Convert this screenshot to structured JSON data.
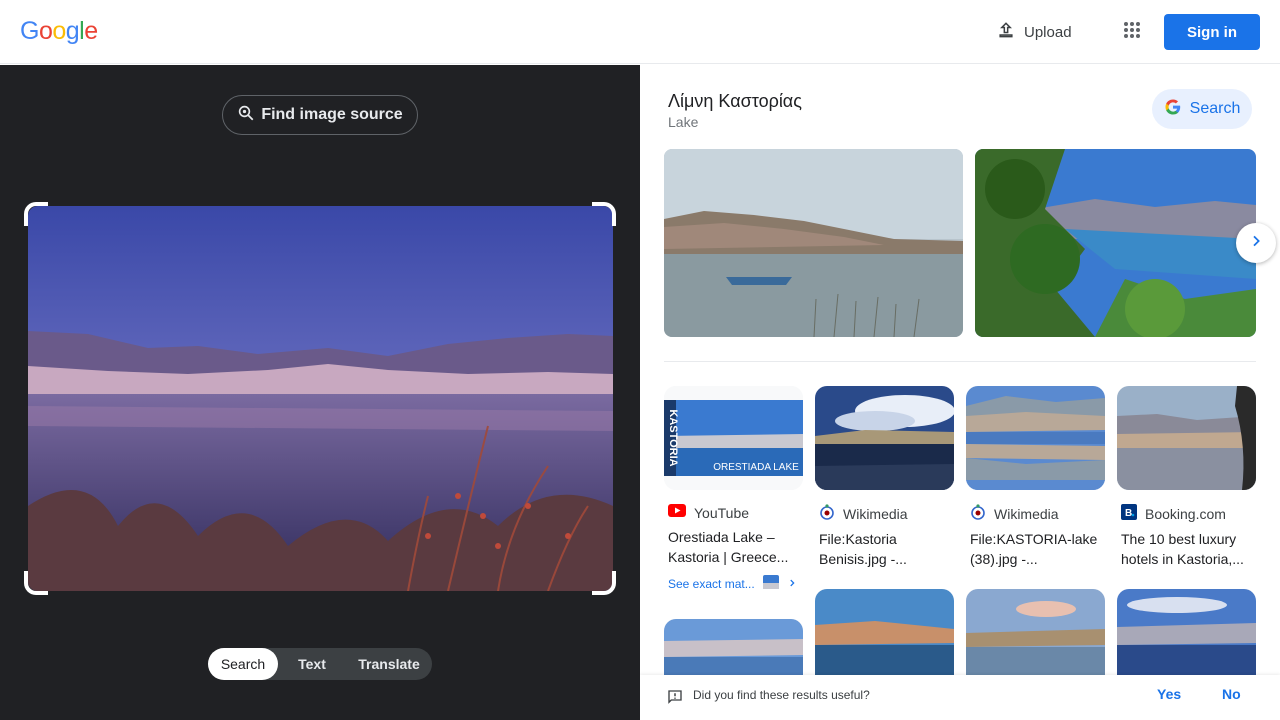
{
  "header": {
    "logo_letters": [
      {
        "ch": "G",
        "color": "#4285F4"
      },
      {
        "ch": "o",
        "color": "#EA4335"
      },
      {
        "ch": "o",
        "color": "#FBBC05"
      },
      {
        "ch": "g",
        "color": "#4285F4"
      },
      {
        "ch": "l",
        "color": "#34A853"
      },
      {
        "ch": "e",
        "color": "#EA4335"
      }
    ],
    "upload_label": "Upload",
    "apps_icon": "apps-grid-icon",
    "signin_label": "Sign in"
  },
  "left": {
    "find_source_label": "Find image source",
    "modes": [
      "Search",
      "Text",
      "Translate"
    ],
    "active_mode": "Search"
  },
  "knowledge_panel": {
    "title": "Λίμνη Καστορίας",
    "subtitle": "Lake",
    "search_label": "Search"
  },
  "results": [
    {
      "source": "YouTube",
      "title": "Orestiada Lake – Kastoria | Greece...",
      "icon": "youtube-icon",
      "image_caption": "ORESTIADA LAKE",
      "image_side_text": "KASTORIA"
    },
    {
      "source": "Wikimedia",
      "title": "File:Kastoria Benisis.jpg -...",
      "icon": "wikimedia-icon"
    },
    {
      "source": "Wikimedia",
      "title": "File:KASTORIA-lake (38).jpg -...",
      "icon": "wikimedia-icon"
    },
    {
      "source": "Booking.com",
      "title": "The 10 best luxury hotels in Kastoria,...",
      "icon": "booking-icon"
    }
  ],
  "see_exact_label": "See exact mat...",
  "feedback": {
    "question": "Did you find these results useful?",
    "yes_label": "Yes",
    "no_label": "No"
  },
  "colors": {
    "accent": "#1a73e8",
    "dark_panel": "#202124",
    "youtube_red": "#ff0000",
    "booking_blue": "#003580"
  }
}
